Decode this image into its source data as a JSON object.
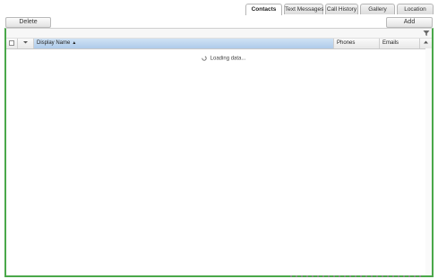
{
  "tabs": [
    {
      "label": "Contacts",
      "active": true
    },
    {
      "label": "Text Messages",
      "active": false
    },
    {
      "label": "Call History",
      "active": false
    },
    {
      "label": "Gallery",
      "active": false
    },
    {
      "label": "Location",
      "active": false
    }
  ],
  "toolbar": {
    "delete_label": "Delete",
    "add_label": "Add"
  },
  "table": {
    "columns": {
      "display_name": "Display Name",
      "phones": "Phones",
      "emails": "Emails"
    },
    "sort_indicator": "▲",
    "sort_column": "Display Name"
  },
  "status": {
    "loading_text": "Loading data..."
  },
  "icons": {
    "filter": "filter-icon",
    "spinner": "spinner-icon",
    "column_menu": "column-menu-icon"
  },
  "colors": {
    "panel_border": "#4aa84a",
    "header_selected": "#aecbea"
  }
}
